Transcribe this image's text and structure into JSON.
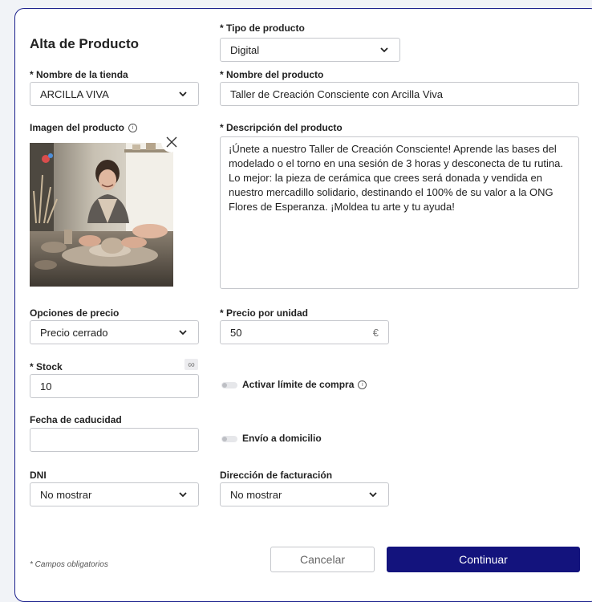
{
  "form": {
    "title": "Alta de Producto",
    "product_type": {
      "label": "* Tipo de producto",
      "value": "Digital"
    },
    "store_name": {
      "label": "* Nombre de la tienda",
      "value": "ARCILLA VIVA"
    },
    "product_name": {
      "label": "* Nombre del producto",
      "value": "Taller de Creación Consciente con Arcilla Viva"
    },
    "product_image": {
      "label": "Imagen del producto",
      "info_icon": "info-icon"
    },
    "description": {
      "label": "* Descripción del producto",
      "value": "¡Únete a nuestro Taller de Creación Consciente! Aprende las bases del modelado o el torno en una sesión de 3 horas y desconecta de tu rutina. Lo mejor: la pieza de cerámica que crees será donada y vendida en nuestro mercadillo solidario, destinando el 100% de su valor a la ONG Flores de Esperanza. ¡Moldea tu arte y tu ayuda!"
    },
    "price_options": {
      "label": "Opciones de precio",
      "value": "Precio cerrado"
    },
    "unit_price": {
      "label": "* Precio por unidad",
      "value": "50",
      "currency": "€"
    },
    "stock": {
      "label": "* Stock",
      "value": "10",
      "unlimited_icon": "∞"
    },
    "purchase_limit": {
      "label": "Activar límite de compra",
      "enabled": false
    },
    "expiry_date": {
      "label": "Fecha de caducidad",
      "value": ""
    },
    "home_delivery": {
      "label": "Envío a domicilio",
      "enabled": false
    },
    "dni": {
      "label": "DNI",
      "value": "No mostrar"
    },
    "billing_address": {
      "label": "Dirección de facturación",
      "value": "No mostrar"
    },
    "required_note": "* Campos obligatorios",
    "cancel_label": "Cancelar",
    "continue_label": "Continuar"
  },
  "colors": {
    "primary": "#13137d",
    "card_border": "#1a1f8c",
    "background": "#f1f3f7"
  }
}
